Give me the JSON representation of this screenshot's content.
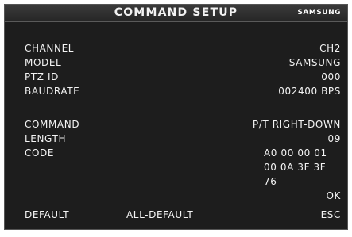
{
  "title": "COMMAND SETUP",
  "brand": "SAMSUNG",
  "settings": {
    "channel": {
      "label": "CHANNEL",
      "value": "CH2"
    },
    "model": {
      "label": "MODEL",
      "value": "SAMSUNG"
    },
    "ptz_id": {
      "label": "PTZ ID",
      "value": "000"
    },
    "baudrate": {
      "label": "BAUDRATE",
      "value": "002400 BPS"
    }
  },
  "command": {
    "command": {
      "label": "COMMAND",
      "value": "P/T RIGHT-DOWN"
    },
    "length": {
      "label": "LENGTH",
      "value": "09"
    },
    "code": {
      "label": "CODE",
      "lines": [
        "A0 00 00 01",
        "00 0A 3F 3F",
        "76"
      ]
    }
  },
  "buttons": {
    "ok": "OK",
    "default": "DEFAULT",
    "all_default": "ALL-DEFAULT",
    "esc": "ESC"
  }
}
